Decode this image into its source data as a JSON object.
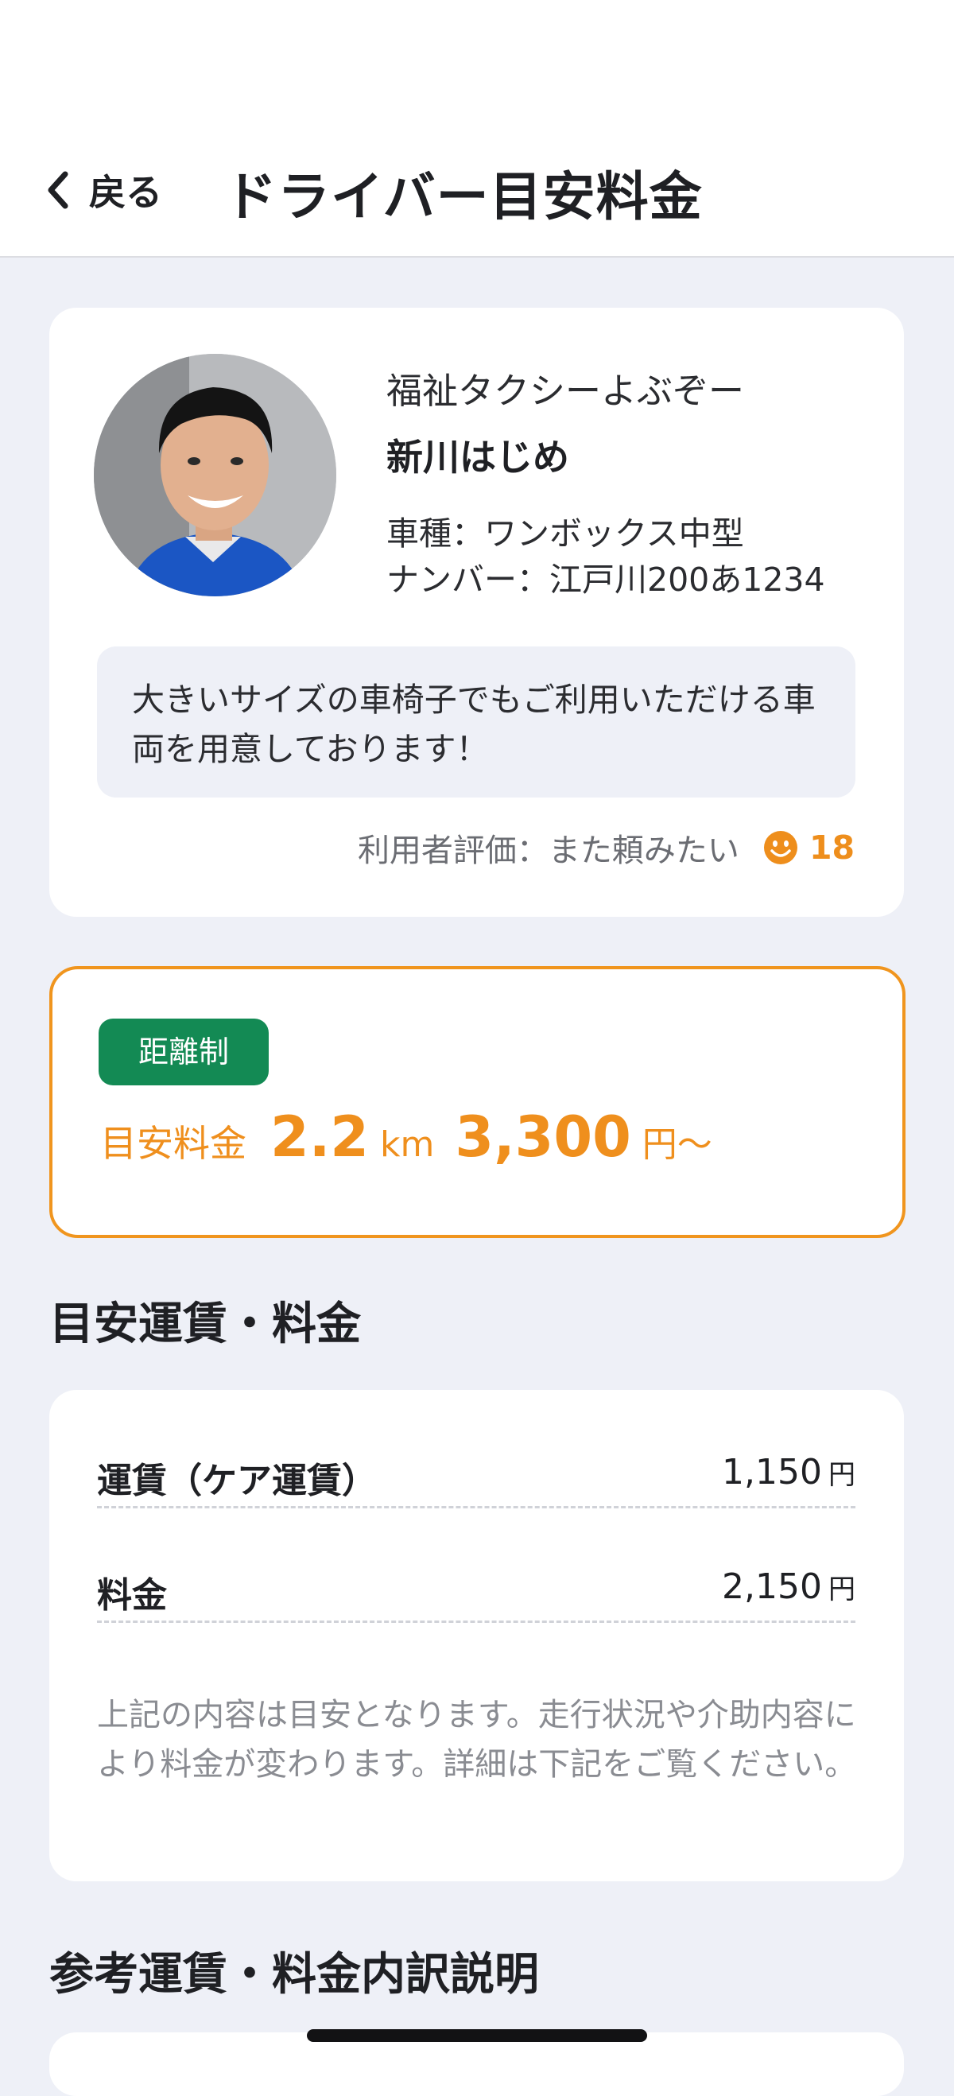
{
  "nav": {
    "back_label": "戻る",
    "title": "ドライバー目安料金"
  },
  "driver": {
    "company": "福祉タクシーよぶぞー",
    "name": "新川はじめ",
    "car_type": "車種：ワンボックス中型",
    "car_number": "ナンバー：江戸川200あ1234",
    "message": "大きいサイズの車椅子でもご利用いただける車両を用意しております！",
    "rating_label": "利用者評価：また頼みたい",
    "rating_count": "18"
  },
  "fare": {
    "badge": "距離制",
    "label": "目安料金",
    "distance": "2.2",
    "distance_unit": "km",
    "amount": "3,300",
    "amount_unit": "円～"
  },
  "breakdown": {
    "section_title": "目安運賃・料金",
    "rows": [
      {
        "label": "運賃（ケア運賃）",
        "value": "1,150",
        "unit": "円"
      },
      {
        "label": "料金",
        "value": "2,150",
        "unit": "円"
      }
    ],
    "note": "上記の内容は目安となります。走行状況や介助内容により料金が変わります。詳細は下記をご覧ください。"
  },
  "reference": {
    "section_title": "参考運賃・料金内訳説明"
  },
  "colors": {
    "accent_orange": "#f0951e",
    "badge_green": "#138a54",
    "background": "#eef0f7"
  },
  "icons": {
    "back": "chevron-left-icon",
    "rating": "smiley-face-icon"
  }
}
